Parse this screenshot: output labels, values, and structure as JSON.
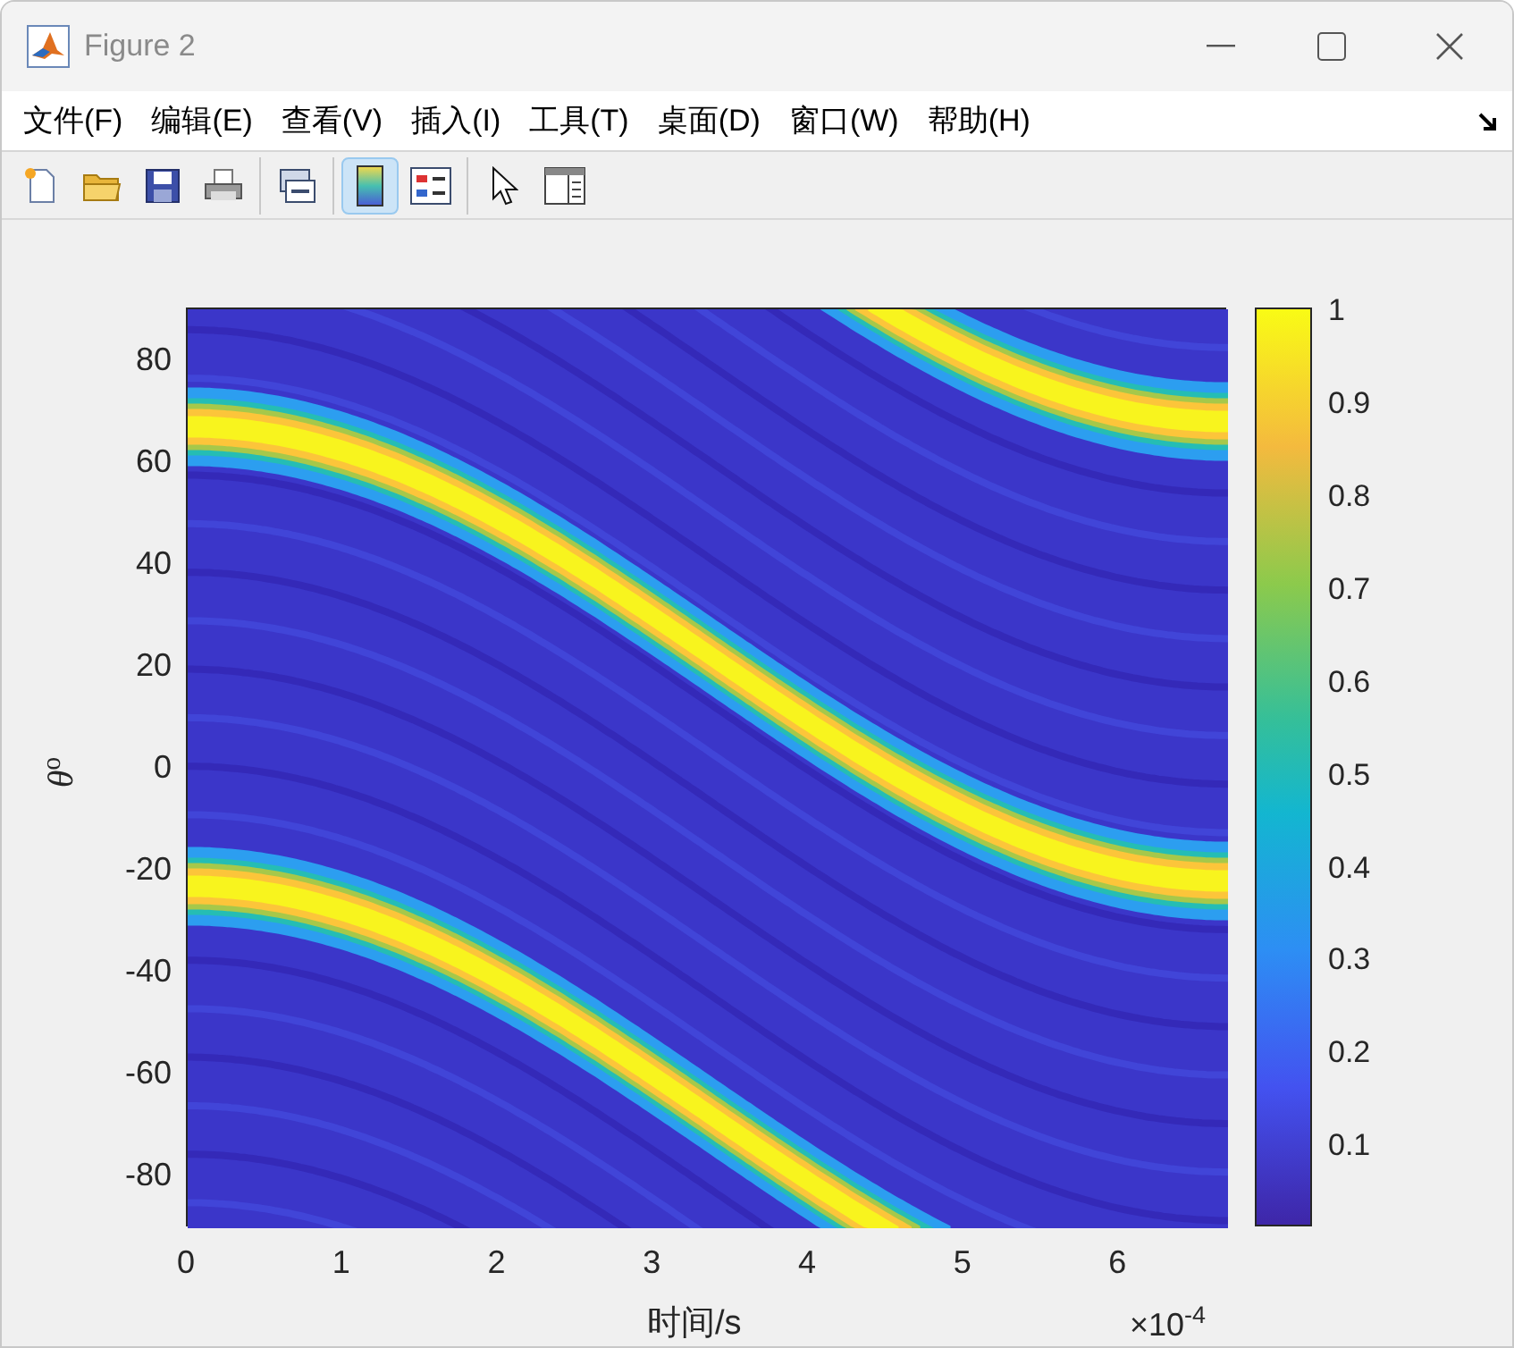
{
  "window": {
    "title": "Figure 2"
  },
  "menu": [
    "文件(F)",
    "编辑(E)",
    "查看(V)",
    "插入(I)",
    "工具(T)",
    "桌面(D)",
    "窗口(W)",
    "帮助(H)"
  ],
  "toolbar": [
    [
      {
        "kind": "new",
        "selected": false
      },
      {
        "kind": "open",
        "selected": false
      },
      {
        "kind": "save",
        "selected": false
      },
      {
        "kind": "print",
        "selected": false
      }
    ],
    [
      {
        "kind": "link",
        "selected": false
      }
    ],
    [
      {
        "kind": "colorbar",
        "selected": true
      },
      {
        "kind": "legend",
        "selected": false
      }
    ],
    [
      {
        "kind": "pointer",
        "selected": false
      },
      {
        "kind": "property",
        "selected": false
      }
    ]
  ],
  "plot": {
    "y_label": "*θ*$^{o}$",
    "x_label": "时间/s",
    "x_exponent": "×10$^{-4}$",
    "x_ticks": [
      "0",
      "1",
      "2",
      "3",
      "4",
      "5",
      "6"
    ],
    "y_ticks": [
      "80",
      "60",
      "40",
      "20",
      "0",
      "-20",
      "-40",
      "-60",
      "-80"
    ],
    "colorbar_ticks": [
      "1",
      "0.9",
      "0.8",
      "0.7",
      "0.6",
      "0.5",
      "0.4",
      "0.3",
      "0.2",
      "0.1"
    ]
  }
}
